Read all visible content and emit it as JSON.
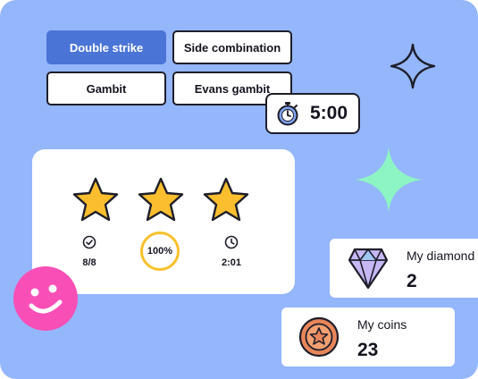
{
  "chips": [
    {
      "label": "Double strike",
      "active": true
    },
    {
      "label": "Side combination",
      "active": false
    },
    {
      "label": "Gambit",
      "active": false
    },
    {
      "label": "Evans gambit",
      "active": false
    }
  ],
  "timer": {
    "value": "5:00",
    "icon": "stopwatch-icon"
  },
  "results": {
    "stars_earned": 3,
    "stars_total": 3,
    "correct": "8/8",
    "accuracy": "100%",
    "time": "2:01"
  },
  "diamonds": {
    "label": "My diamond",
    "value": "2",
    "icon": "diamond-icon"
  },
  "coins": {
    "label": "My coins",
    "value": "23",
    "icon": "coin-icon"
  },
  "colors": {
    "background": "#94B6FA",
    "active_chip": "#4A74D6",
    "star": "#FBBE2E",
    "accent_pink": "#F84FB7",
    "sparkle_mint": "#8DF5C4"
  }
}
